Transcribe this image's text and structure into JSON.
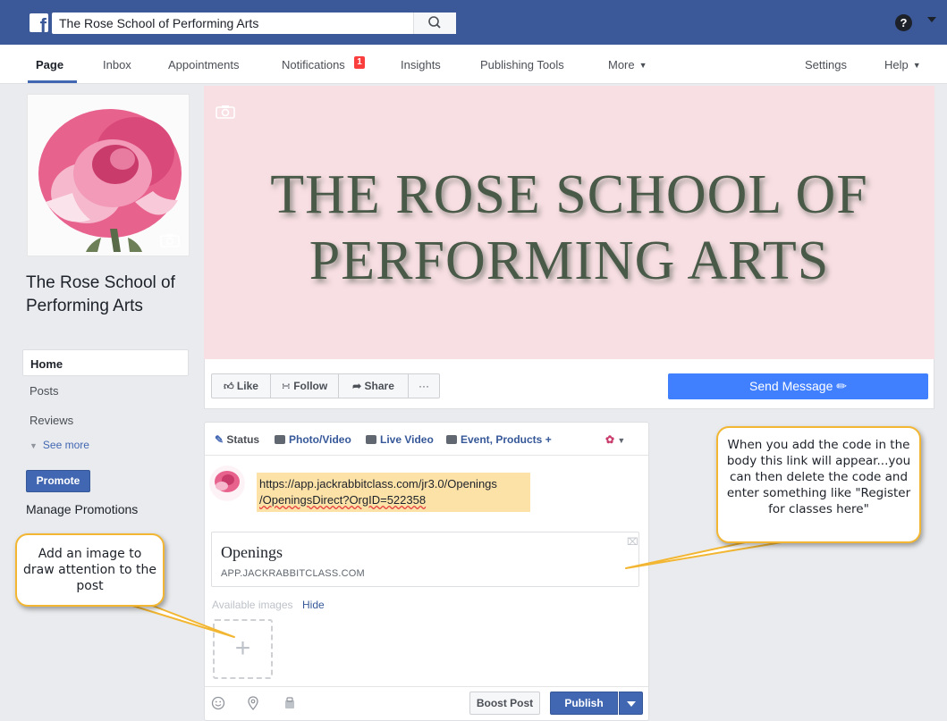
{
  "topbar": {
    "search_value": "The Rose School of Performing Arts",
    "logo_letter": "f",
    "help_glyph": "?"
  },
  "nav": {
    "page": "Page",
    "inbox": "Inbox",
    "appointments": "Appointments",
    "notifications": "Notifications",
    "notifications_count": "1",
    "insights": "Insights",
    "publishing_tools": "Publishing Tools",
    "more": "More",
    "settings": "Settings",
    "help": "Help"
  },
  "sidebar": {
    "page_name": "The Rose School of Performing Arts",
    "items": [
      {
        "label": "Home"
      },
      {
        "label": "Posts"
      },
      {
        "label": "Reviews"
      }
    ],
    "see_more": "See more",
    "promote": "Promote",
    "manage_promotions": "Manage Promotions"
  },
  "cover": {
    "title_line1": "THE ROSE SCHOOL OF",
    "title_line2": "PERFORMING ARTS",
    "bg_color": "#f8dfe3"
  },
  "actions": {
    "like": "Like",
    "follow": "Follow",
    "share": "Share",
    "more": "···",
    "send_message": "Send Message"
  },
  "composer": {
    "tabs": {
      "status": "Status",
      "photo_video": "Photo/Video",
      "live_video": "Live Video",
      "event_products": "Event, Products +"
    },
    "link_text_line1": "https://app.jackrabbitclass.com/jr3.0/Openings",
    "link_text_line2": "/OpeningsDirect?OrgID=522358",
    "card_title": "Openings",
    "card_domain": "APP.JACKRABBITCLASS.COM",
    "available_images": "Available images",
    "hide": "Hide",
    "boost_post": "Boost Post",
    "publish": "Publish"
  },
  "callouts": {
    "left": "Add an image to draw attention to the post",
    "right": "When you add the code in the body this link will appear...you can then delete the code and enter something like \"Register for classes here\""
  },
  "colors": {
    "fb_blue": "#3b5998",
    "button_blue": "#4267b2",
    "send_blue": "#4080ff",
    "callout_border": "#f2b632",
    "highlight": "#fde2a8"
  }
}
